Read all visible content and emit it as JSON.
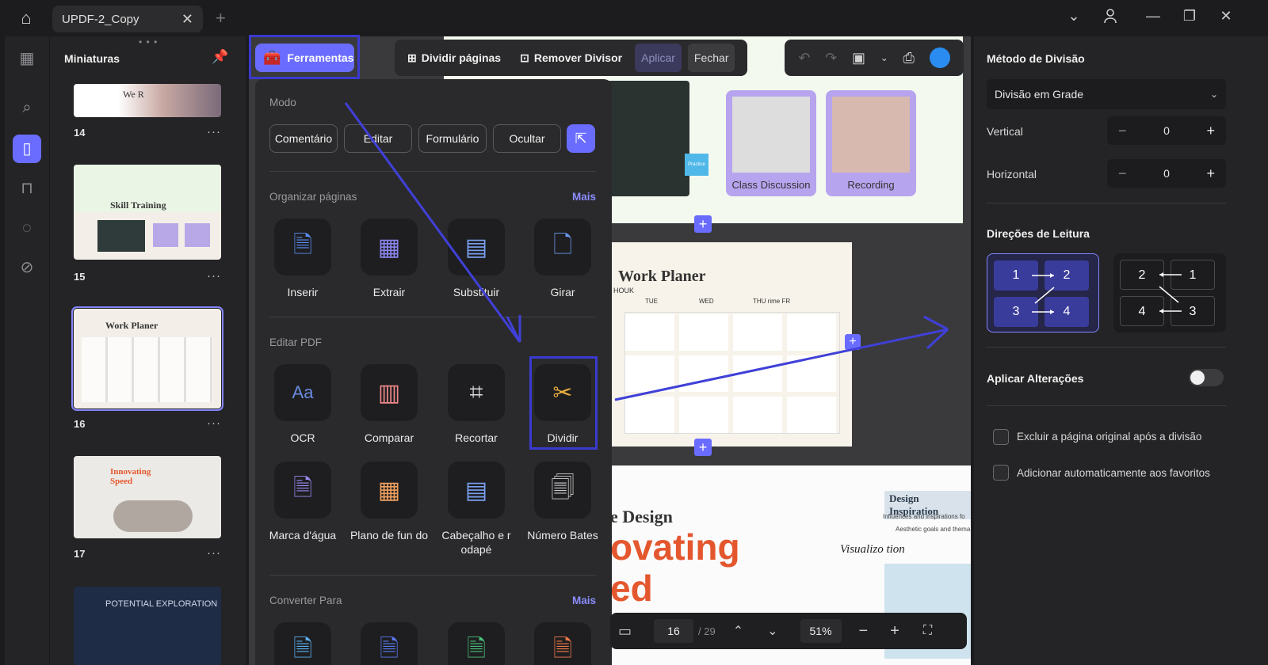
{
  "tab": {
    "title": "UPDF-2_Copy"
  },
  "thumbnails": {
    "header": "Miniaturas",
    "items": [
      {
        "page": "14",
        "more": "···",
        "text": "We R"
      },
      {
        "page": "15",
        "more": "···",
        "text": "Skill Training"
      },
      {
        "page": "16",
        "more": "···",
        "text": "Work Planer"
      },
      {
        "page": "17",
        "more": "···",
        "text": "Innovating Speed"
      },
      {
        "page": "",
        "more": "",
        "text": "POTENTIAL EXPLORATION"
      }
    ]
  },
  "toolbar": {
    "ferramentas": "Ferramentas",
    "dividir_paginas": "Dividir páginas",
    "remover_divisor": "Remover Divisor",
    "aplicar": "Aplicar",
    "fechar": "Fechar"
  },
  "tools_panel": {
    "modo": "Modo",
    "modes": [
      "Comentário",
      "Editar",
      "Formulário",
      "Ocultar"
    ],
    "organizar": "Organizar páginas",
    "mais": "Mais",
    "organize_tools": [
      "Inserir",
      "Extrair",
      "Substituir",
      "Girar"
    ],
    "editar_pdf": "Editar PDF",
    "edit_tools": [
      "OCR",
      "Comparar",
      "Recortar",
      "Dividir"
    ],
    "more_tools": [
      "Marca d'água",
      "Plano de fun do",
      "Cabeçalho e r odapé",
      "Número Bates"
    ],
    "converter": "Converter Para"
  },
  "document": {
    "page15_labels": [
      "Class Discussion",
      "Recording",
      "Practice"
    ],
    "page16_title": "Work Planer",
    "page16_sub": "HOUK",
    "days": [
      "TUE",
      "WED",
      "THU rime FR"
    ],
    "page17_text": [
      "Design Inspiration",
      "e Design",
      "ovating",
      "ed",
      "Visualizo tion"
    ],
    "page17_bullets": [
      "Influences and inspirations fo",
      "Aesthetic goals and thema"
    ]
  },
  "right_panel": {
    "metodo": "Método de Divisão",
    "metodo_value": "Divisão em Grade",
    "vertical": "Vertical",
    "vertical_value": "0",
    "horizontal": "Horizontal",
    "horizontal_value": "0",
    "direcoes": "Direções de Leitura",
    "grid_a": [
      "1",
      "2",
      "3",
      "4"
    ],
    "grid_b": [
      "2",
      "1",
      "4",
      "3"
    ],
    "aplicar_alteracoes": "Aplicar Alterações",
    "opt1": "Excluir a página original após a divisão",
    "opt2": "Adicionar automaticamente aos favoritos"
  },
  "bottom": {
    "page": "16",
    "total": "/ 29",
    "zoom": "51%"
  },
  "colors": {
    "accent": "#6a6cff",
    "annotation": "#3a3ad0"
  }
}
